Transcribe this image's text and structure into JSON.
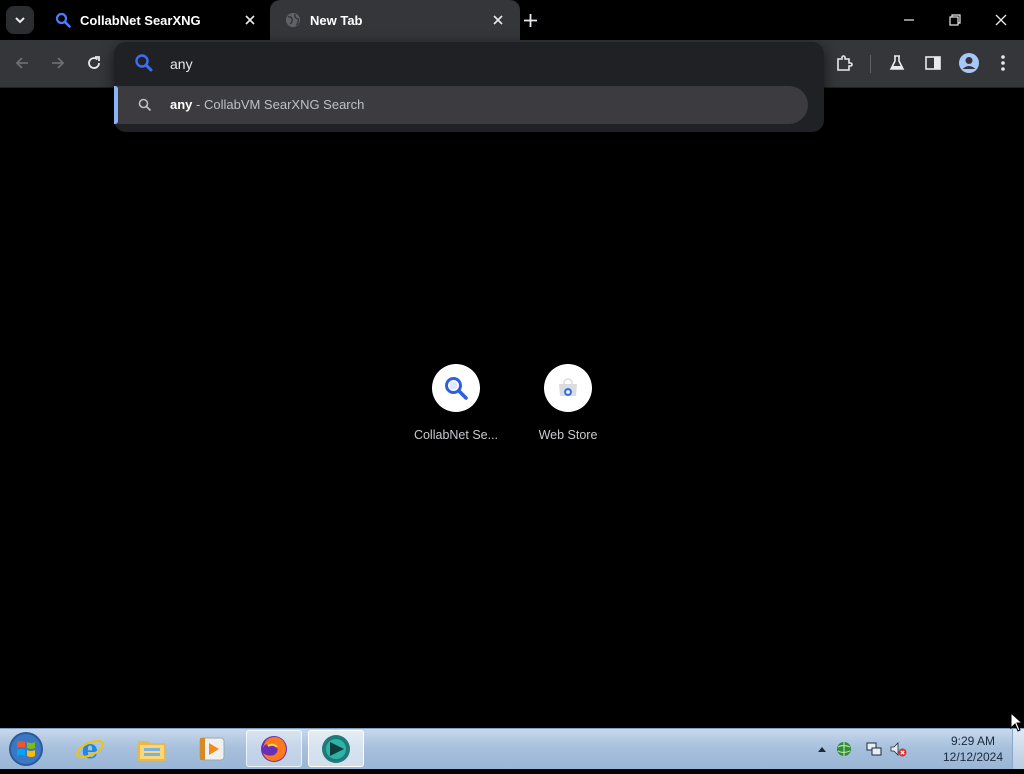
{
  "colors": {
    "accent_blue": "#8ab4f8",
    "search_icon_blue": "#3d6cf5",
    "toolbar_bg": "#35363a",
    "popup_bg": "#202124",
    "page_bg": "#000000"
  },
  "tabs": [
    {
      "title": "CollabNet SearXNG",
      "icon": "search-icon",
      "active": false
    },
    {
      "title": "New Tab",
      "icon": "globe-icon",
      "active": true
    }
  ],
  "omnibox": {
    "value": "any",
    "placeholder": "",
    "suggestion": {
      "query": "any",
      "separator": " - ",
      "engine": "CollabVM SearXNG Search"
    }
  },
  "shortcuts": [
    {
      "label": "CollabNet Se...",
      "icon": "search-icon"
    },
    {
      "label": "Web Store",
      "icon": "web-store-icon"
    }
  ],
  "taskbar": {
    "items": [
      "internet-explorer-icon",
      "file-explorer-icon",
      "media-player-icon",
      "firefox-icon",
      "browser-icon"
    ],
    "clock": {
      "time": "9:29 AM",
      "date": "12/12/2024"
    }
  }
}
